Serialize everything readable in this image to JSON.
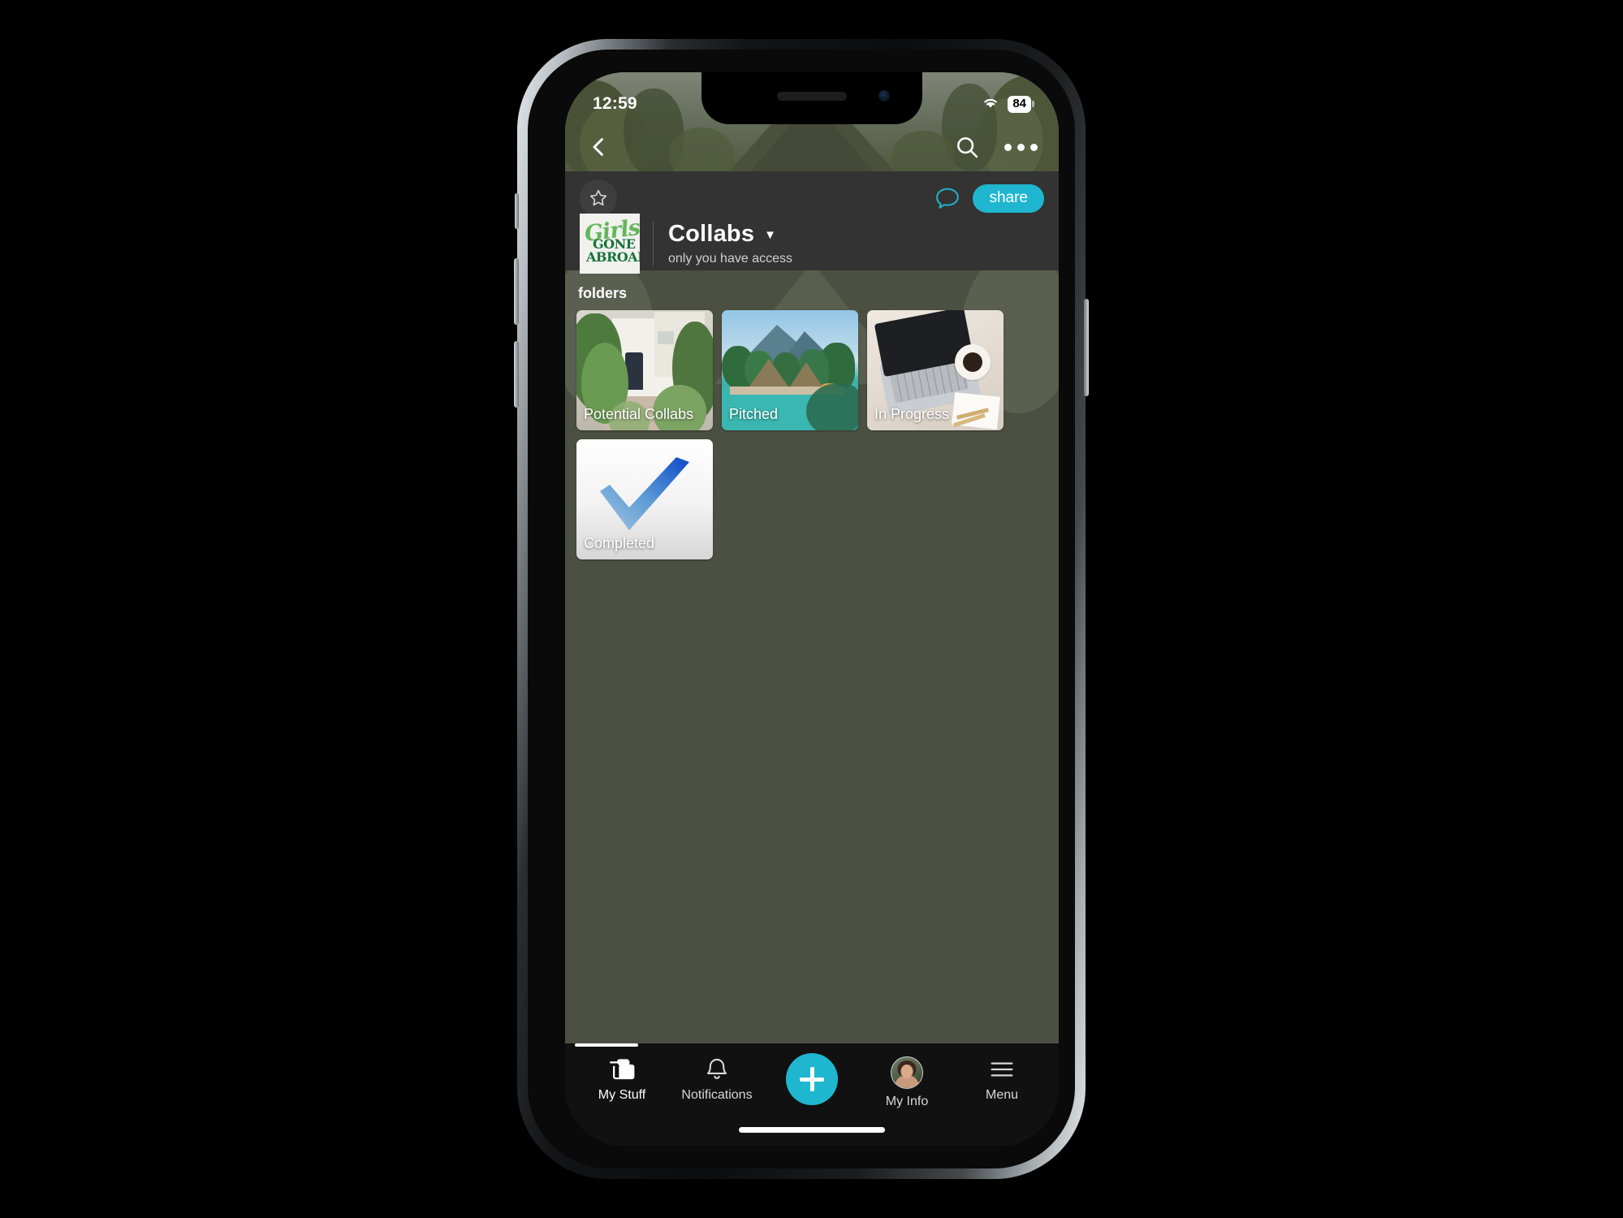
{
  "status_bar": {
    "time": "12:59",
    "wifi_icon": "wifi-icon",
    "battery_level": "84"
  },
  "hero_nav": {
    "back_icon": "chevron-left-icon",
    "search_icon": "search-icon",
    "overflow_icon": "more-horizontal-icon"
  },
  "header": {
    "star_icon": "star-outline-icon",
    "comment_icon": "comment-bubble-icon",
    "share_label": "share",
    "logo": {
      "line1": "Girls",
      "line2": "GONE",
      "line3": "ABROAD"
    },
    "title": "Collabs",
    "caret_icon": "chevron-down-icon",
    "subtitle": "only you have access"
  },
  "body": {
    "section_label": "folders",
    "folders": [
      {
        "name": "Potential Collabs",
        "thumb": "villa-thumbnail"
      },
      {
        "name": "Pitched",
        "thumb": "resort-pool-thumbnail"
      },
      {
        "name": "In Progress",
        "thumb": "laptop-desk-thumbnail"
      },
      {
        "name": "Completed",
        "thumb": "blue-checkmark-thumbnail"
      }
    ]
  },
  "tab_bar": {
    "tabs": [
      {
        "label": "My Stuff",
        "icon": "folder-icon",
        "active": true
      },
      {
        "label": "Notifications",
        "icon": "bell-icon",
        "active": false
      },
      {
        "label": "My Info",
        "icon": "avatar-icon",
        "active": false
      },
      {
        "label": "Menu",
        "icon": "hamburger-menu-icon",
        "active": false
      }
    ],
    "add_button_icon": "plus-icon"
  },
  "colors": {
    "accent": "#1fb6d0",
    "header_bg": "#333333",
    "body_bg": "#4c5042",
    "tabbar_bg": "#111111",
    "logo_script_green": "#63b65b",
    "logo_dark_green": "#14733a"
  }
}
